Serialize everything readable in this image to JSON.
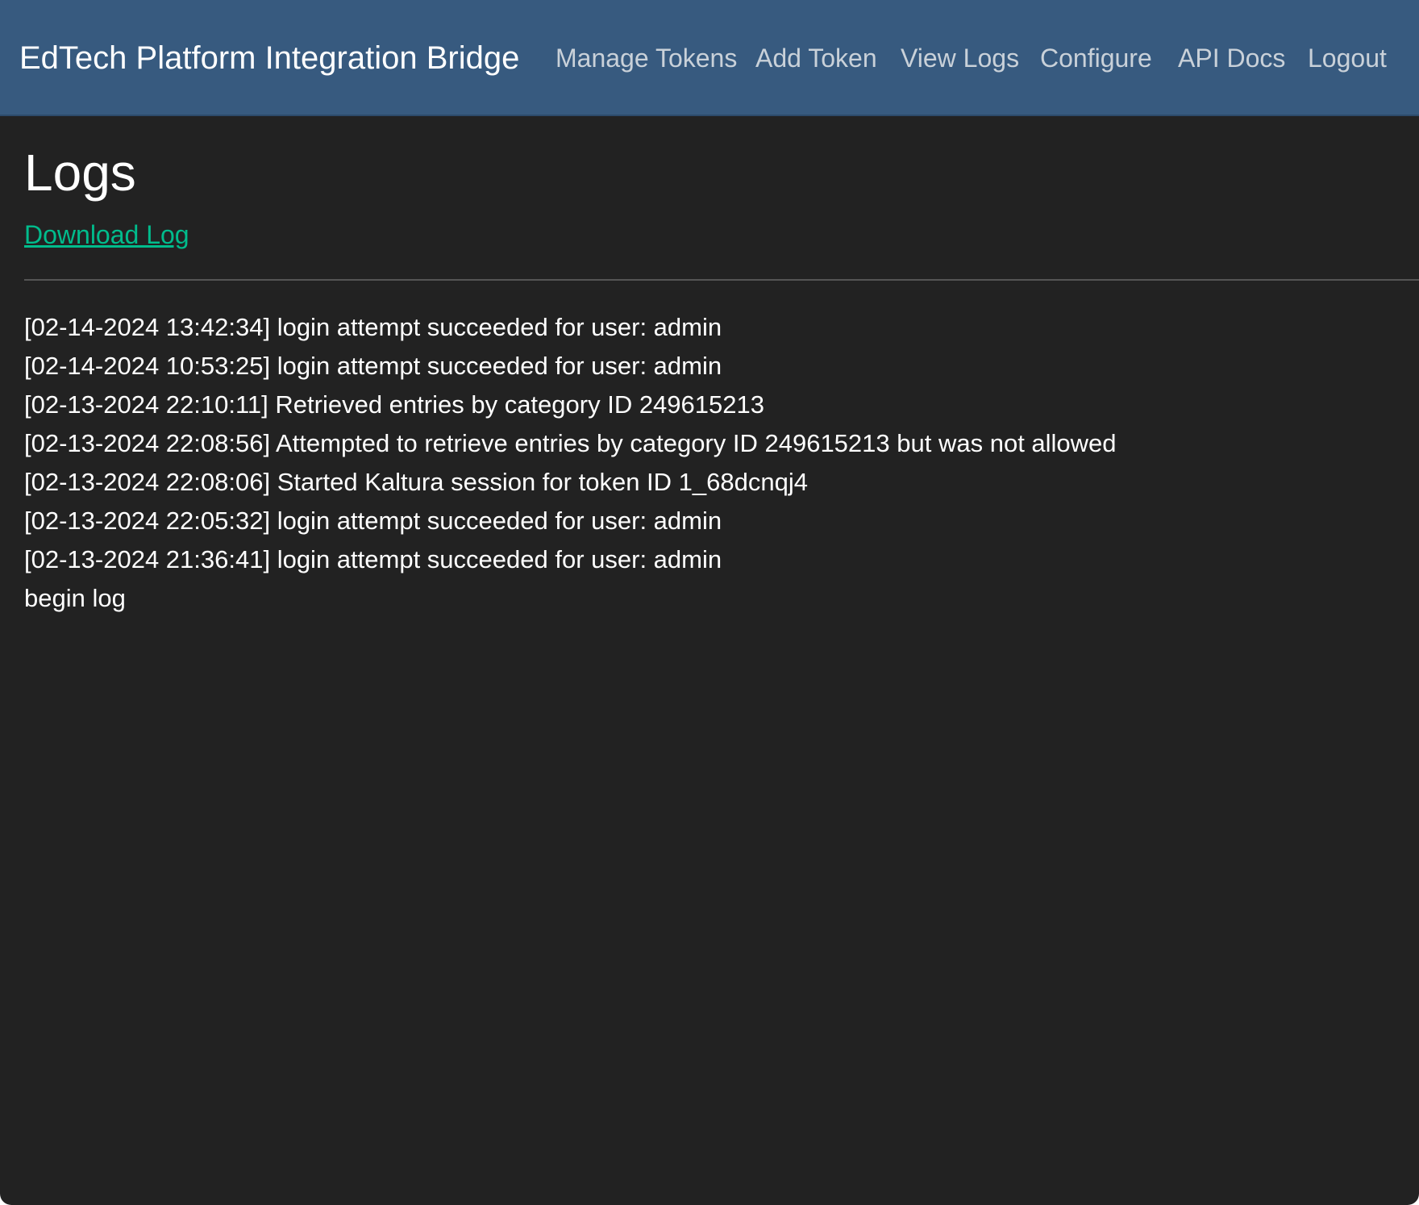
{
  "header": {
    "brand": "EdTech Platform Integration Bridge",
    "nav": [
      {
        "label": "Manage Tokens"
      },
      {
        "label": "Add Token"
      },
      {
        "label": "View Logs"
      },
      {
        "label": "Configure"
      },
      {
        "label": "API Docs"
      },
      {
        "label": "Logout"
      }
    ]
  },
  "main": {
    "title": "Logs",
    "download_label": "Download Log",
    "log_lines": [
      "[02-14-2024 13:42:34] login attempt succeeded for user: admin",
      "[02-14-2024 10:53:25] login attempt succeeded for user: admin",
      "[02-13-2024 22:10:11] Retrieved entries by category ID 249615213",
      "[02-13-2024 22:08:56] Attempted to retrieve entries by category ID 249615213 but was not allowed",
      "[02-13-2024 22:08:06] Started Kaltura session for token ID 1_68dcnqj4",
      "[02-13-2024 22:05:32] login attempt succeeded for user: admin",
      "[02-13-2024 21:36:41] login attempt succeeded for user: admin",
      "begin log"
    ]
  },
  "colors": {
    "navbar_bg": "#375a7f",
    "page_bg": "#222222",
    "link": "#00bc8c",
    "nav_text": "#c9d1d9"
  }
}
